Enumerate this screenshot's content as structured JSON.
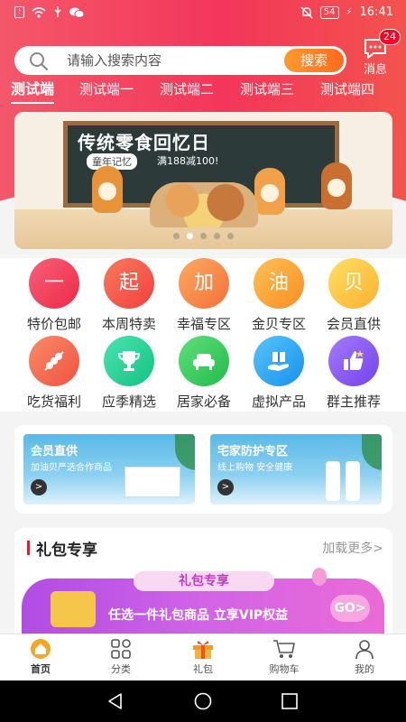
{
  "status_bar": {
    "time": "16:41",
    "battery": "54"
  },
  "search": {
    "placeholder": "请输入搜索内容",
    "button": "搜索"
  },
  "message": {
    "label": "消息",
    "badge": "24"
  },
  "tabs": [
    "测试端",
    "测试端一",
    "测试端二",
    "测试端三",
    "测试端四"
  ],
  "banner": {
    "title": "传统零食回忆日",
    "subtitle": "童年记忆",
    "promo": "满188减100!"
  },
  "quick_entries": [
    {
      "label": "特价包邮",
      "glyph": "一",
      "color": "#f0435b",
      "icon": "text"
    },
    {
      "label": "本周特卖",
      "glyph": "起",
      "color": "#f6584a",
      "icon": "text"
    },
    {
      "label": "幸福专区",
      "glyph": "加",
      "color": "#f8884a",
      "icon": "text"
    },
    {
      "label": "金贝专区",
      "glyph": "油",
      "color": "#fba03a",
      "icon": "text"
    },
    {
      "label": "会员直供",
      "glyph": "贝",
      "color": "#fbc53a",
      "icon": "text"
    },
    {
      "label": "吃货福利",
      "glyph": "",
      "color": "#f6715a",
      "icon": "skewer-icon"
    },
    {
      "label": "应季精选",
      "glyph": "",
      "color": "#2bd49a",
      "icon": "trophy-icon"
    },
    {
      "label": "居家必备",
      "glyph": "",
      "color": "#3ccf62",
      "icon": "sofa-icon"
    },
    {
      "label": "虚拟产品",
      "glyph": "",
      "color": "#2fa9f4",
      "icon": "gift-hand-icon"
    },
    {
      "label": "群主推荐",
      "glyph": "",
      "color": "#8c5cf2",
      "icon": "thumbs-up-icon"
    }
  ],
  "promos": [
    {
      "title": "会员直供",
      "subtitle": "加油贝严选合作商品",
      "go": ">"
    },
    {
      "title": "宅家防护专区",
      "subtitle": "线上购物 安全健康",
      "go": ">"
    }
  ],
  "gift": {
    "title": "礼包专享",
    "more": "加载更多>",
    "pill": "礼包专享",
    "text": "任选一件礼包商品 立享VIP权益",
    "go": "GO>"
  },
  "nav": [
    {
      "label": "首页",
      "icon": "home-icon"
    },
    {
      "label": "分类",
      "icon": "category-icon"
    },
    {
      "label": "礼包",
      "icon": "gift-icon"
    },
    {
      "label": "购物车",
      "icon": "cart-icon"
    },
    {
      "label": "我的",
      "icon": "profile-icon"
    }
  ]
}
